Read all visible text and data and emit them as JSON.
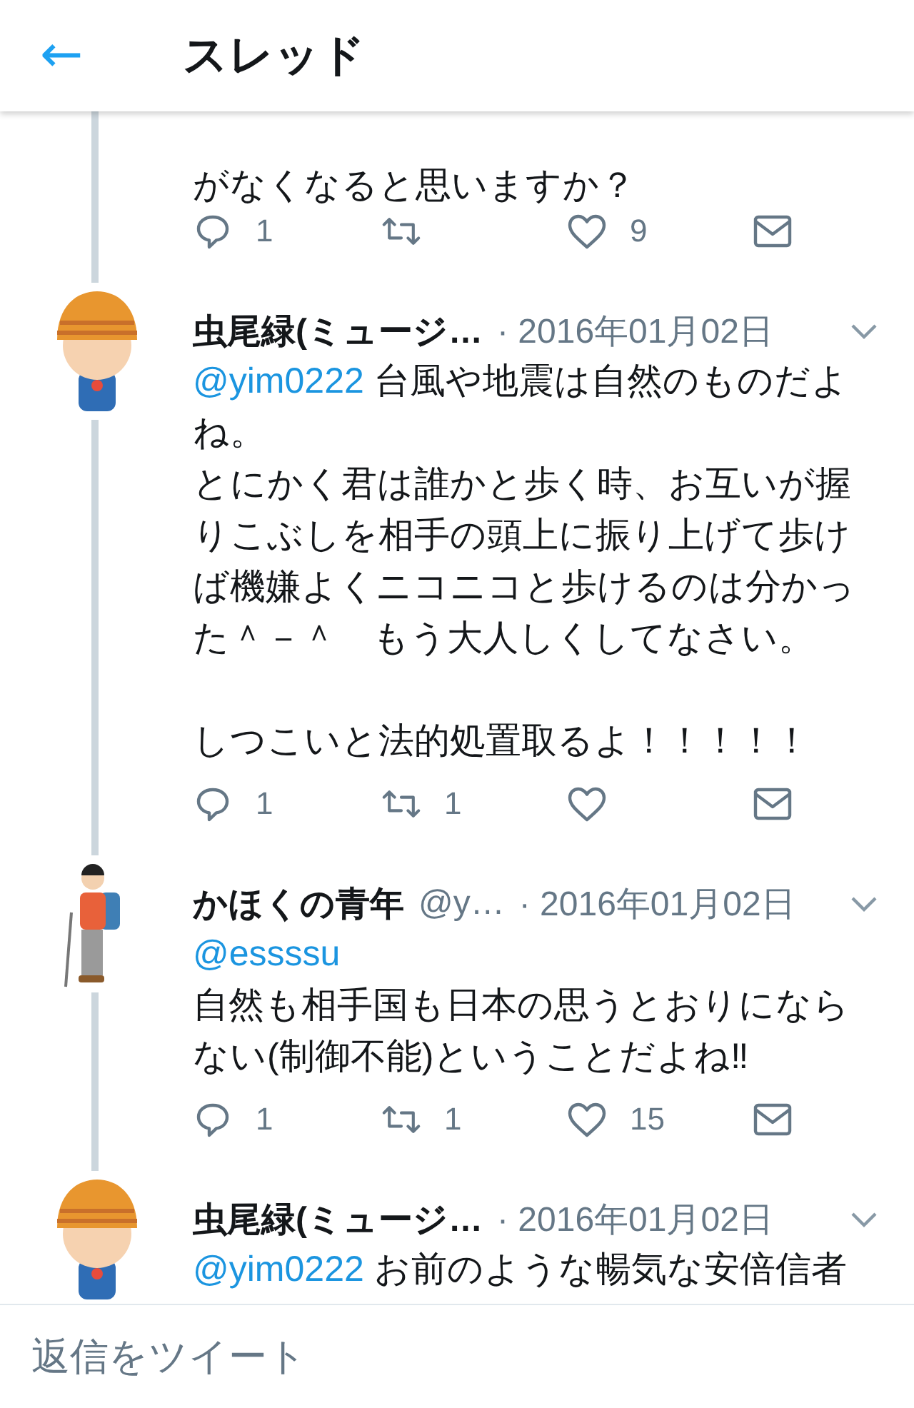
{
  "header": {
    "back": "←",
    "title": "スレッド"
  },
  "fragment": {
    "body": [
      [
        {
          "text": "がなくなると思いますか？"
        }
      ]
    ],
    "actions": {
      "replies": "1",
      "likes": "9"
    }
  },
  "tweets": [
    {
      "avatar": {
        "kind": "cap"
      },
      "name": "虫尾緑(ミュージ…",
      "date": "· 2016年01月02日",
      "body": [
        [
          {
            "mention": "@yim0222",
            "text": "台風や地震は自然のものだよね。"
          },
          {
            "text": "とにかく君は誰かと歩く時、お互いが握りこぶしを相手の頭上に振り上げて歩けば機嫌よくニコニコと歩けるのは分かった＾－＾　もう大人しくしてなさい。"
          }
        ],
        [
          {
            "text": "しつこいと法的処置取るよ！！！！！"
          }
        ]
      ],
      "actions": {
        "replies": "1",
        "retweets": "1"
      }
    },
    {
      "avatar": {
        "kind": "hiker"
      },
      "name": "かほくの青年",
      "handle": "@y…",
      "date": "· 2016年01月02日",
      "body": [
        [
          {
            "mention": "@essssu"
          },
          {
            "text": "自然も相手国も日本の思うとおりにならない(制御不能)ということだよね‼"
          }
        ]
      ],
      "actions": {
        "replies": "1",
        "retweets": "1",
        "likes": "15"
      }
    },
    {
      "avatar": {
        "kind": "cap"
      },
      "name": "虫尾緑(ミュージ…",
      "date": "· 2016年01月02日",
      "body": [
        [
          {
            "mention": "@yim0222",
            "text": "お前のような暢気な安倍信者"
          }
        ]
      ]
    }
  ],
  "reply_bar": {
    "placeholder": "返信をツイート"
  }
}
